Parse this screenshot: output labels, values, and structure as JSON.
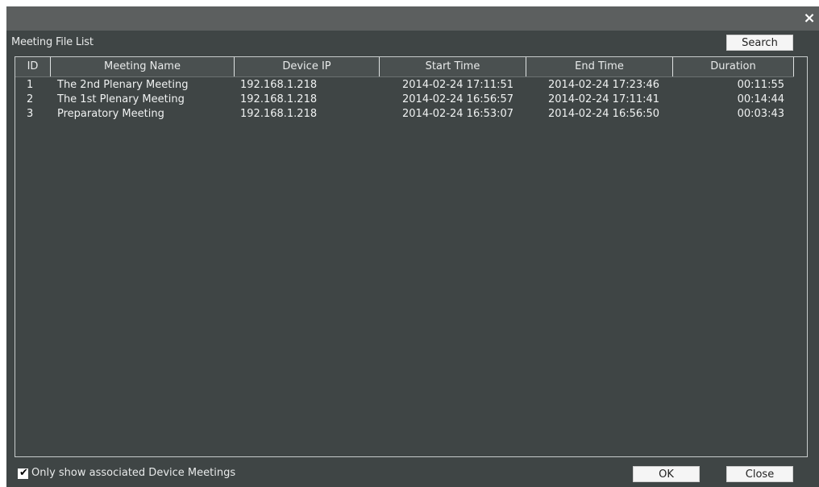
{
  "dialog": {
    "section_title": "Meeting File List",
    "search_label": "Search",
    "ok_label": "OK",
    "close_label": "Close",
    "close_icon": "×",
    "checkbox": {
      "label": "Only show associated Device Meetings",
      "checked": true,
      "tick": "✔"
    }
  },
  "table": {
    "columns": [
      "ID",
      "Meeting Name",
      "Device IP",
      "Start Time",
      "End Time",
      "Duration"
    ],
    "rows": [
      {
        "id": "1",
        "name": "The 2nd Plenary Meeting",
        "ip": "192.168.1.218",
        "start": "2014-02-24 17:11:51",
        "end": "2014-02-24 17:23:46",
        "duration": "00:11:55"
      },
      {
        "id": "2",
        "name": "The 1st Plenary Meeting",
        "ip": "192.168.1.218",
        "start": "2014-02-24 16:56:57",
        "end": "2014-02-24 17:11:41",
        "duration": "00:14:44"
      },
      {
        "id": "3",
        "name": "Preparatory Meeting",
        "ip": "192.168.1.218",
        "start": "2014-02-24 16:53:07",
        "end": "2014-02-24 16:56:50",
        "duration": "00:03:43"
      }
    ]
  }
}
